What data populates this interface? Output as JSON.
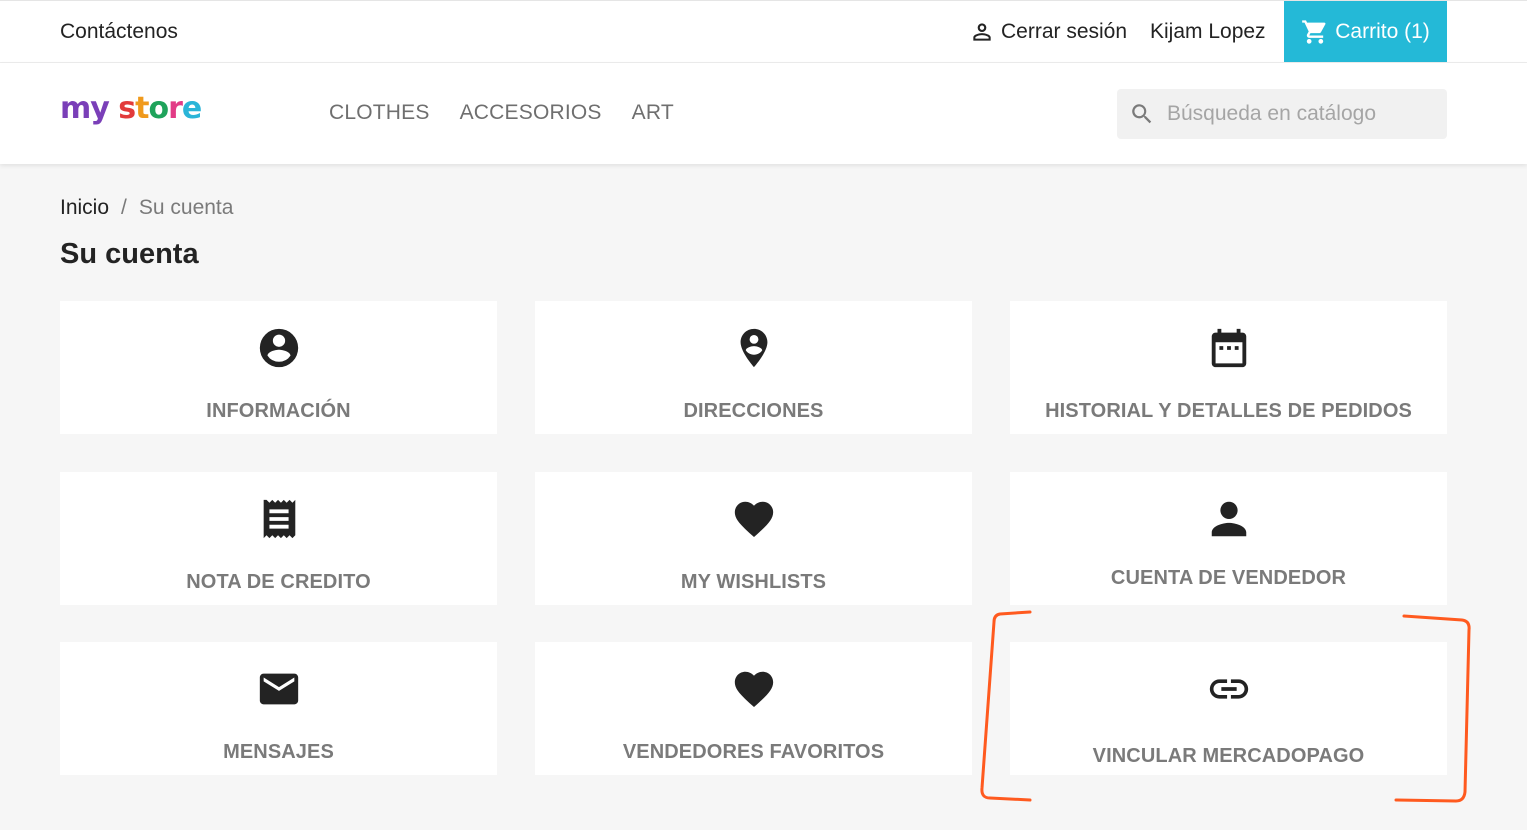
{
  "topbar": {
    "contact": "Contáctenos",
    "logout": "Cerrar sesión",
    "username": "Kijam Lopez",
    "cart": "Carrito (1)"
  },
  "header": {
    "logo": [
      "my",
      " ",
      "s",
      "t",
      "o",
      "r",
      "e"
    ],
    "nav": [
      "CLOTHES",
      "ACCESORIOS",
      "ART"
    ],
    "search_placeholder": "Búsqueda en catálogo"
  },
  "breadcrumb": {
    "home": "Inicio",
    "separator": "/",
    "current": "Su cuenta"
  },
  "page_title": "Su cuenta",
  "cards": [
    {
      "label": "INFORMACIÓN",
      "icon": "account-circle-icon"
    },
    {
      "label": "DIRECCIONES",
      "icon": "location-pin-icon"
    },
    {
      "label": "HISTORIAL Y DETALLES DE PEDIDOS",
      "icon": "calendar-icon"
    },
    {
      "label": "NOTA DE CREDITO",
      "icon": "receipt-icon"
    },
    {
      "label": "MY WISHLISTS",
      "icon": "heart-icon"
    },
    {
      "label": "CUENTA DE VENDEDOR",
      "icon": "person-icon"
    },
    {
      "label": "MENSAJES",
      "icon": "mail-icon"
    },
    {
      "label": "VENDEDORES FAVORITOS",
      "icon": "heart-icon"
    },
    {
      "label": "VINCULAR MERCADOPAGO",
      "icon": "link-icon"
    }
  ],
  "colors": {
    "cart_bg": "#24b9d7",
    "annotation": "#ff5a1f",
    "label_gray": "#7a7a7a"
  }
}
